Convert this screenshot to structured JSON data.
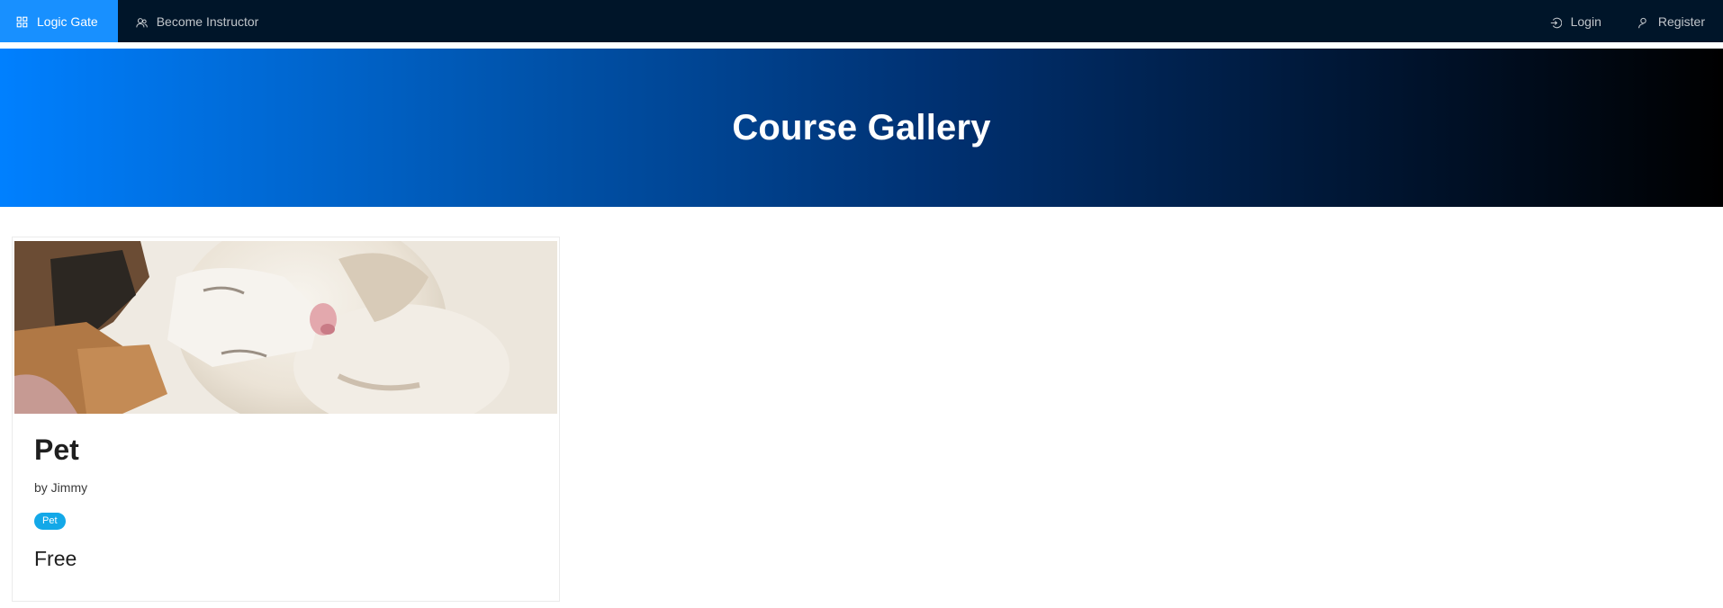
{
  "nav": {
    "brand_label": "Logic Gate",
    "become_instructor_label": "Become Instructor",
    "login_label": "Login",
    "register_label": "Register",
    "active_color": "#1890ff",
    "bar_color": "#001529"
  },
  "banner": {
    "title": "Course Gallery"
  },
  "courses": [
    {
      "title": "Pet",
      "author": "by Jimmy",
      "tag": "Pet",
      "price": "Free"
    }
  ]
}
